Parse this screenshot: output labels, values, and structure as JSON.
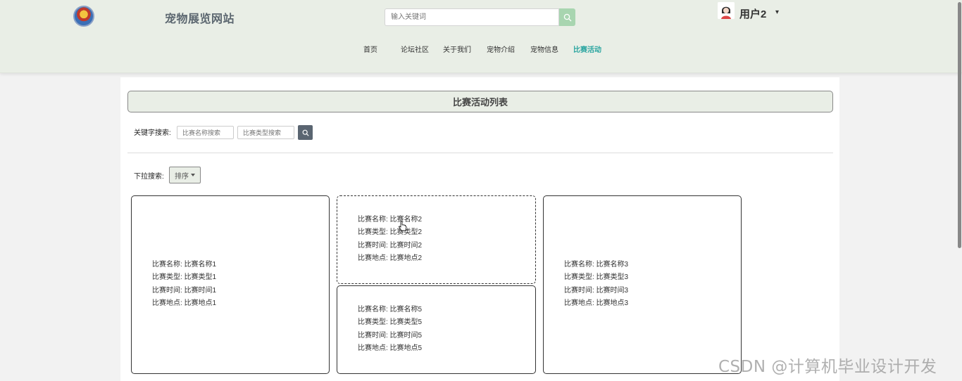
{
  "header": {
    "site_title": "宠物展览网站",
    "search_placeholder": "输入关键词",
    "username": "用户2",
    "user_caret": "▾",
    "nav": [
      {
        "label": "首页",
        "active": false
      },
      {
        "label": "论坛社区",
        "active": false
      },
      {
        "label": "关于我们",
        "active": false
      },
      {
        "label": "宠物介绍",
        "active": false
      },
      {
        "label": "宠物信息",
        "active": false
      },
      {
        "label": "比赛活动",
        "active": true
      }
    ]
  },
  "main": {
    "list_title": "比赛活动列表",
    "keyword_label": "关键字搜索:",
    "name_search_placeholder": "比赛名称搜索",
    "type_search_placeholder": "比赛类型搜索",
    "dropdown_label": "下拉搜索:",
    "sort_label": "排序",
    "cards": [
      {
        "lines": [
          "比赛名称: 比赛名称1",
          "比赛类型: 比赛类型1",
          "比赛时间: 比赛时间1",
          "比赛地点: 比赛地点1"
        ]
      },
      {
        "lines": [
          "比赛名称: 比赛名称2",
          "比赛类型: 比赛类型2",
          "比赛时间: 比赛时间2",
          "比赛地点: 比赛地点2"
        ]
      },
      {
        "lines": [
          "比赛名称: 比赛名称3",
          "比赛类型: 比赛类型3",
          "比赛时间: 比赛时间3",
          "比赛地点: 比赛地点3"
        ]
      },
      {
        "lines": [
          "比赛名称: 比赛名称5",
          "比赛类型: 比赛类型5",
          "比赛时间: 比赛时间5",
          "比赛地点: 比赛地点5"
        ]
      }
    ]
  },
  "watermark": "CSDN @计算机毕业设计开发",
  "colors": {
    "header_bg": "#e9eee6",
    "active_nav": "#2aa5a0",
    "search_button": "#a8d5b0",
    "keyword_button": "#5a6571"
  },
  "icons": {
    "logo": "site-logo-icon",
    "search": "search-icon",
    "avatar": "user-avatar-icon",
    "cursor": "hand-pointer-icon"
  }
}
